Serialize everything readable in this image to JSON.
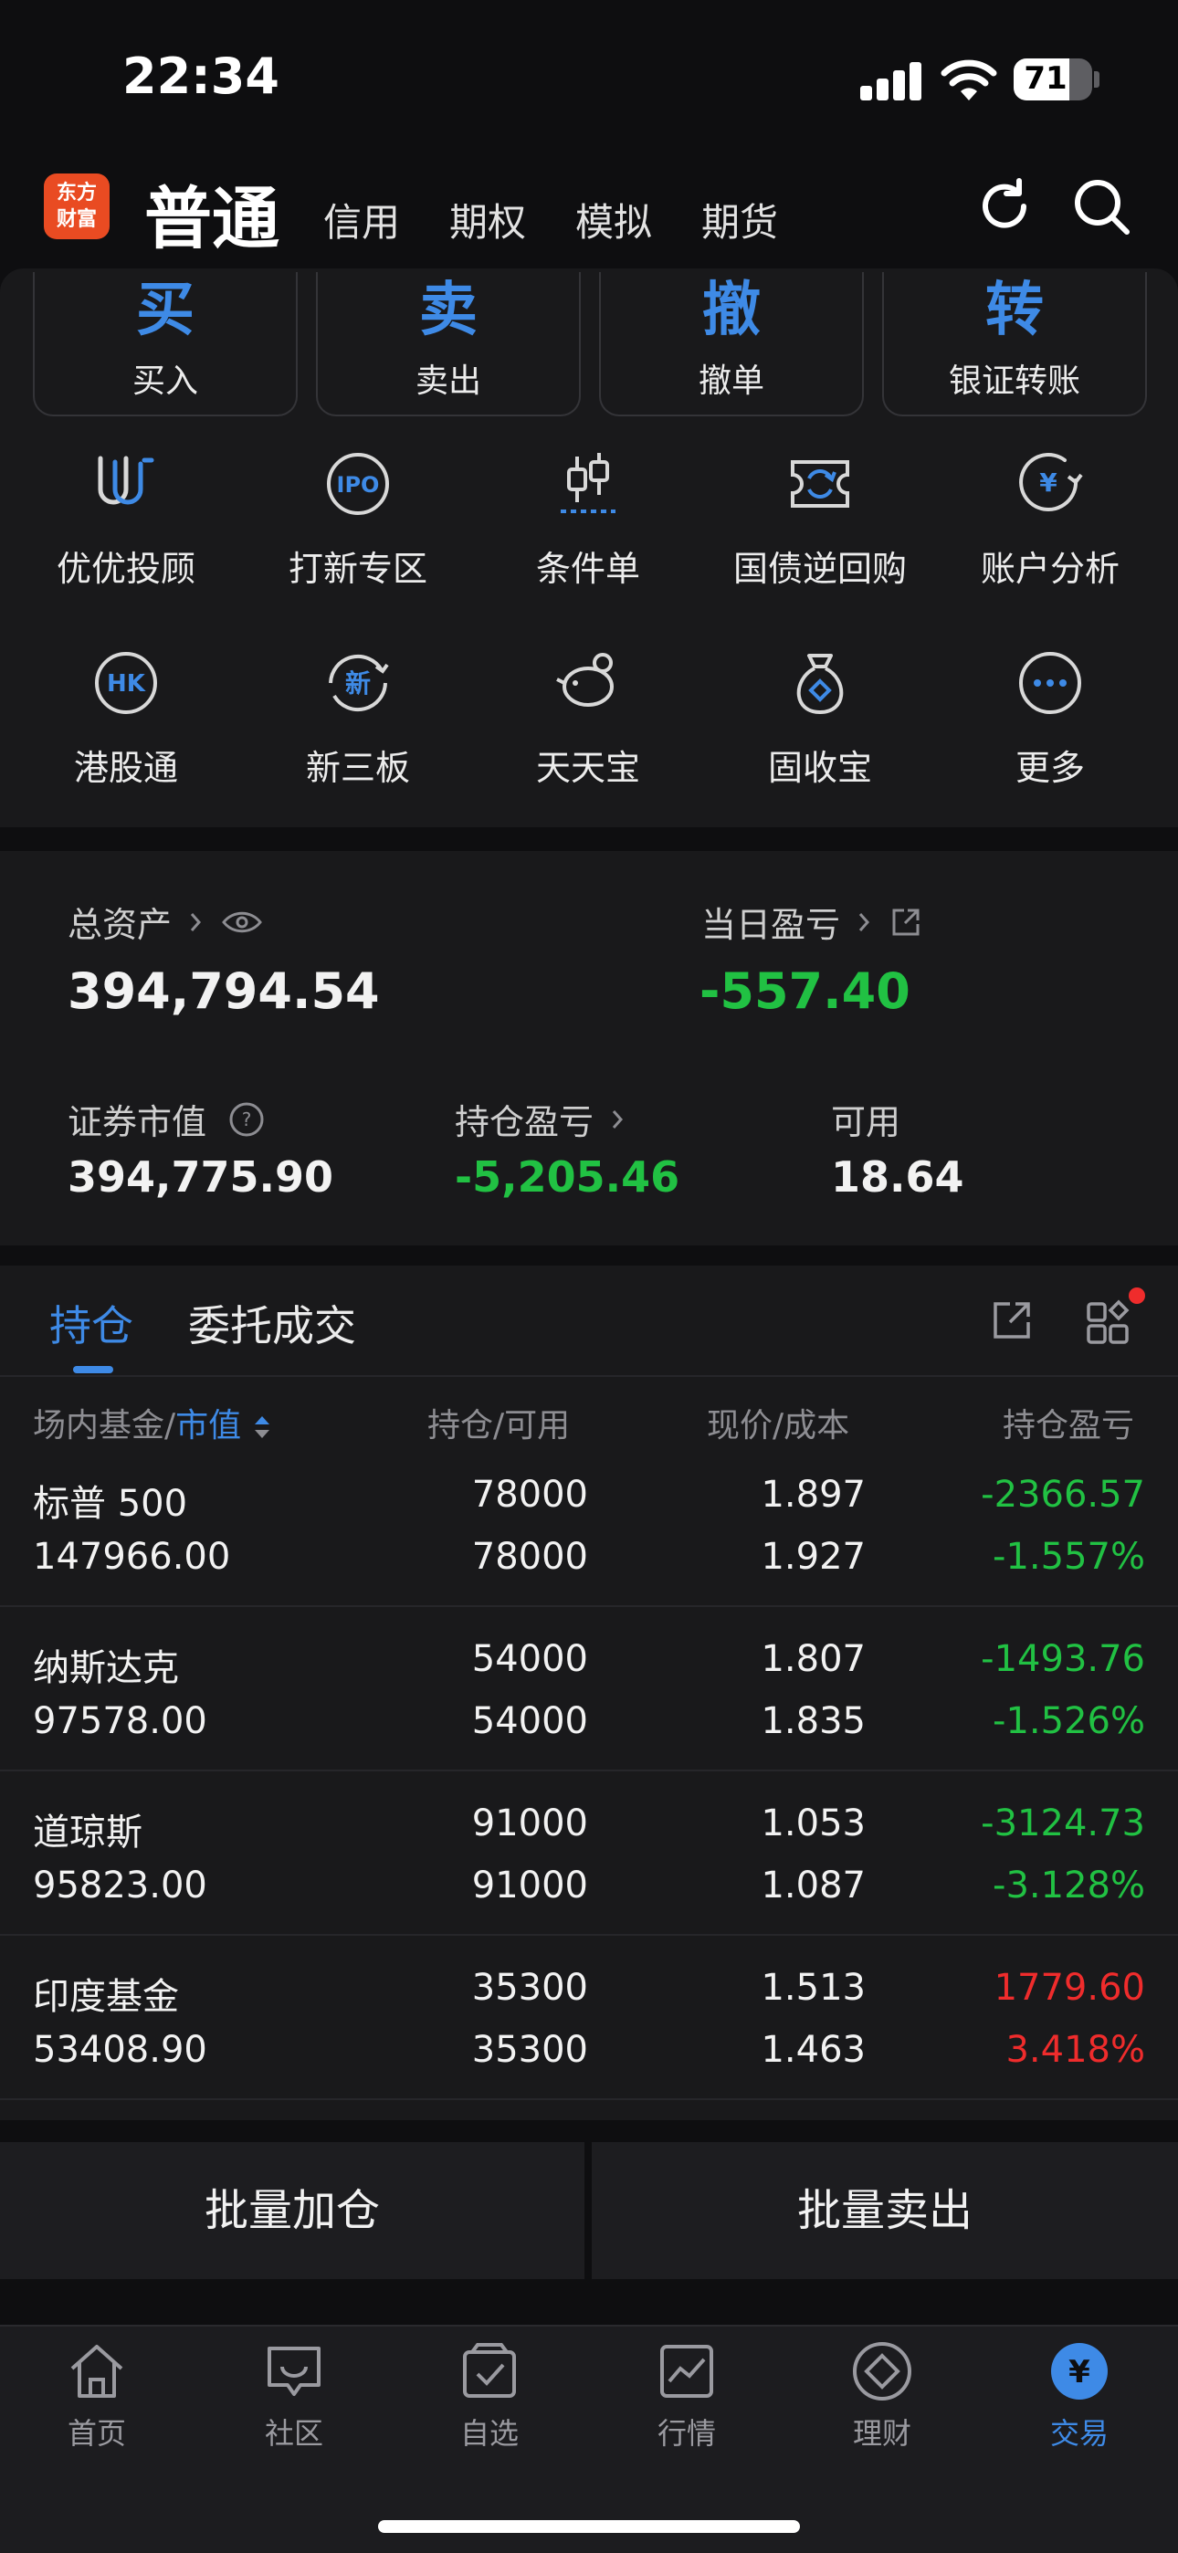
{
  "status_bar": {
    "time": "22:34",
    "battery": "71",
    "battery_level": 0.71
  },
  "header": {
    "logo_line1": "东方",
    "logo_line2": "财富",
    "tabs": [
      {
        "label": "普通",
        "active": true
      },
      {
        "label": "信用"
      },
      {
        "label": "期权"
      },
      {
        "label": "模拟"
      },
      {
        "label": "期货"
      }
    ]
  },
  "quick_actions": [
    {
      "glyph": "买",
      "label": "买入"
    },
    {
      "glyph": "卖",
      "label": "卖出"
    },
    {
      "glyph": "撤",
      "label": "撤单"
    },
    {
      "glyph": "转",
      "label": "银证转账"
    }
  ],
  "services": [
    {
      "label": "优优投顾",
      "icon": "uu-advisor-icon"
    },
    {
      "label": "打新专区",
      "icon": "ipo-icon"
    },
    {
      "label": "条件单",
      "icon": "candlestick-icon"
    },
    {
      "label": "国债逆回购",
      "icon": "bond-repo-icon"
    },
    {
      "label": "账户分析",
      "icon": "account-analysis-icon"
    },
    {
      "label": "港股通",
      "icon": "hk-icon"
    },
    {
      "label": "新三板",
      "icon": "new-third-board-icon"
    },
    {
      "label": "天天宝",
      "icon": "piggy-bank-icon"
    },
    {
      "label": "固收宝",
      "icon": "money-bag-icon"
    },
    {
      "label": "更多",
      "icon": "more-icon"
    }
  ],
  "assets": {
    "total_label": "总资产",
    "total_value": "394,794.54",
    "daily_pl_label": "当日盈亏",
    "daily_pl_value": "-557.40",
    "market_value_label": "证券市值",
    "market_value": "394,775.90",
    "position_pl_label": "持仓盈亏",
    "position_pl_value": "-5,205.46",
    "available_label": "可用",
    "available_value": "18.64"
  },
  "holdings": {
    "tabs": [
      "持仓",
      "委托成交"
    ],
    "columns": {
      "c1a": "场内基金",
      "c1b": "市值",
      "c2": "持仓/可用",
      "c3": "现价/成本",
      "c4": "持仓盈亏"
    },
    "rows": [
      {
        "name": "标普 500",
        "value": "147966.00",
        "qty": "78000",
        "avail": "78000",
        "price": "1.897",
        "cost": "1.927",
        "pl": "-2366.57",
        "pl_pct": "-1.557%",
        "up": false
      },
      {
        "name": "纳斯达克",
        "value": "97578.00",
        "qty": "54000",
        "avail": "54000",
        "price": "1.807",
        "cost": "1.835",
        "pl": "-1493.76",
        "pl_pct": "-1.526%",
        "up": false
      },
      {
        "name": "道琼斯",
        "value": "95823.00",
        "qty": "91000",
        "avail": "91000",
        "price": "1.053",
        "cost": "1.087",
        "pl": "-3124.73",
        "pl_pct": "-3.128%",
        "up": false
      },
      {
        "name": "印度基金",
        "value": "53408.90",
        "qty": "35300",
        "avail": "35300",
        "price": "1.513",
        "cost": "1.463",
        "pl": "1779.60",
        "pl_pct": "3.418%",
        "up": true
      }
    ]
  },
  "bottom_actions": {
    "batch_add": "批量加仓",
    "batch_sell": "批量卖出"
  },
  "nav": [
    {
      "label": "首页",
      "icon": "home-icon"
    },
    {
      "label": "社区",
      "icon": "community-icon"
    },
    {
      "label": "自选",
      "icon": "watchlist-icon"
    },
    {
      "label": "行情",
      "icon": "market-icon"
    },
    {
      "label": "理财",
      "icon": "wealth-icon"
    },
    {
      "label": "交易",
      "icon": "trade-icon",
      "active": true
    }
  ],
  "colors": {
    "accent": "#3e8ae6",
    "loss": "#21c143",
    "gain": "#ef2c2c",
    "logo": "#e94b22"
  }
}
